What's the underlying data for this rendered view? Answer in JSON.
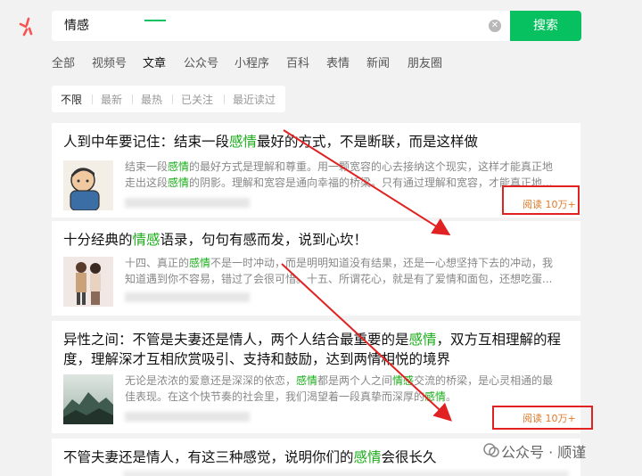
{
  "search": {
    "query": "情感",
    "button_label": "搜索",
    "clear_glyph": "✕"
  },
  "tabs": [
    "全部",
    "视频号",
    "文章",
    "公众号",
    "小程序",
    "百科",
    "表情",
    "新闻",
    "朋友圈"
  ],
  "active_tab": "文章",
  "filters": [
    "不限",
    "最新",
    "最热",
    "已关注",
    "最近读过"
  ],
  "results": [
    {
      "title_parts": [
        "人到中年要记住：结束一段",
        "感情",
        "最好的方式，不是断联，而是这样做"
      ],
      "snippet1_parts": [
        "结束一段",
        "感情",
        "的最好方式是理解和尊重。用一颗宽容的心去接纳这个现实，这样才能真正地"
      ],
      "snippet2_parts": [
        "走出这段",
        "感情",
        "的阴影。理解和宽容是通向幸福的桥梁。只有通过理解和宽容，才能真正地..."
      ],
      "read": "阅读 10万+"
    },
    {
      "title_parts": [
        "十分经典的",
        "情感",
        "语录，句句有感而发，说到心坎！"
      ],
      "snippet1_parts": [
        "十四、真正的",
        "感情",
        "不是一时冲动，而是明明知道没有结果，还是一心想坚持下去的冲动，我"
      ],
      "snippet2_parts": [
        "知道遇到你不容易，错过了会很可惜。十五、所谓花心，就是有了爱情和面包，还想吃蛋..."
      ],
      "read": ""
    },
    {
      "title_line1_parts": [
        "异性之间：不管是夫妻还是情人，两个人结合最重要的是",
        "感情",
        "，双方互相理解的程"
      ],
      "title_line2": "度，理解深才互相欣赏吸引、支持和鼓励，达到两情相悦的境界",
      "snippet1_parts": [
        "无论是浓浓的爱意还是深深的依恋，",
        "感情",
        "都是两个人之间",
        "情感",
        "交流的桥梁，是心灵相通的最"
      ],
      "snippet2_parts": [
        "佳表现。在这个快节奏的社会里，我们渴望着一段真挚而深厚的",
        "感情",
        "。"
      ],
      "read": "阅读 10万+"
    },
    {
      "title_parts": [
        "不管夫妻还是情人，有这三种感觉，说明你们的",
        "感情",
        "会很长久"
      ]
    }
  ],
  "watermark": "公众号 · 顺谨",
  "colors": {
    "accent": "#07c160",
    "highlight": "#1aad19",
    "annotation": "#e02222",
    "read": "#e07a2a"
  },
  "icons": {
    "logo": "wechat-search-logo-icon",
    "clear": "clear-icon",
    "watermark": "wechat-official-account-icon"
  }
}
